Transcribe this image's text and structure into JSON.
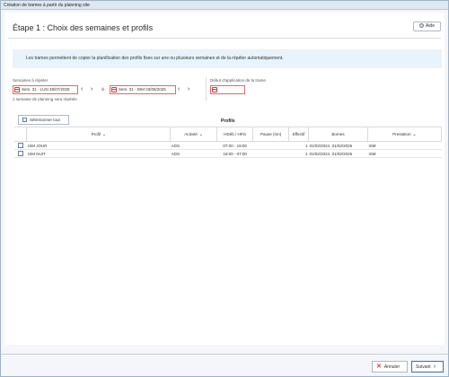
{
  "window": {
    "title": "Création de trames à partir du planning site"
  },
  "header": {
    "title": "Étape 1 : Choix des semaines et profils",
    "help_label": "Aide"
  },
  "info_banner": "Les trames permettent de copier la planification des profils fixes sur une ou plusieurs semaines et de la répéter automatiquement.",
  "weeks": {
    "label": "Semaines à répéter",
    "from": "Sem. 31 - LUN 28/07/2025",
    "separator": "à",
    "to": "Sem. 31 - DIM 03/08/2025",
    "summary": "1 semaine de planning sera répétée"
  },
  "start": {
    "label": "Début d'application de la trame",
    "value": ""
  },
  "profiles": {
    "select_all_label": "Sélectionner tout",
    "title": "Profils",
    "columns": {
      "profil": "Profil",
      "activite": "Activité",
      "hours": "HDéb / HFin",
      "pause": "Pause (mn)",
      "effectif": "Effectif",
      "bornes": "Bornes",
      "prestation": "Prestation"
    },
    "rows": [
      {
        "profil": "ISM JOUR",
        "activite": "ADS",
        "hours": "07:00 - 19:00",
        "effectif": "1",
        "borne_start": "01/02/2024",
        "borne_end": "01/02/2026",
        "prestation": "ISM"
      },
      {
        "profil": "ISM NUIT",
        "activite": "ADS",
        "hours": "19:00 - 07:00",
        "effectif": "1",
        "borne_start": "01/02/2024",
        "borne_end": "01/02/2026",
        "prestation": "ISM"
      }
    ]
  },
  "footer": {
    "cancel_label": "Annuler",
    "next_label": "Suivant"
  }
}
